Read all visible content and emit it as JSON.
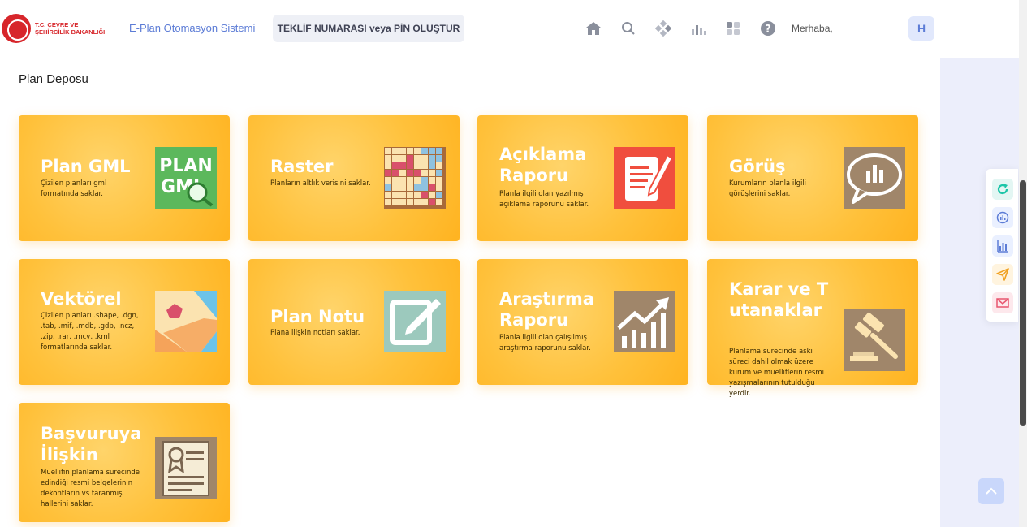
{
  "header": {
    "logo_line1": "T.C. ÇEVRE VE",
    "logo_line2": "ŞEHİRCİLİK BAKANLIĞI",
    "app_name": "E-Plan Otomasyon Sistemi",
    "teklif_label": "TEKLİF NUMARASI veya PİN OLUŞTUR",
    "greeting": "Merhaba,",
    "avatar_letter": "H",
    "icons": [
      "home-icon",
      "search-icon",
      "apps-icon",
      "chart-icon",
      "grid-icon",
      "help-icon"
    ]
  },
  "page": {
    "title": "Plan Deposu"
  },
  "cards": [
    {
      "title": "Plan GML",
      "desc": "Çizilen planları gml formatında saklar.",
      "icon": "plan-gml-icon"
    },
    {
      "title": "Raster",
      "desc": "Planların altlık verisini saklar.",
      "icon": "raster-grid-icon"
    },
    {
      "title": "Açıklama Raporu",
      "desc": "Planla ilgili olan yazılmış açıklama raporunu saklar.",
      "icon": "report-edit-icon"
    },
    {
      "title": "Görüş",
      "desc": "Kurumların planla ilgili görüşlerini saklar.",
      "icon": "speech-chart-icon"
    },
    {
      "title": "Vektörel",
      "desc": "Çizilen planları .shape, .dgn, .tab, .mif, .mdb, .gdb, .ncz, .zip, .rar, .mcv, .kml formatlarında saklar.",
      "icon": "vector-map-icon"
    },
    {
      "title": "Plan Notu",
      "desc": "Plana ilişkin notları saklar.",
      "icon": "note-edit-icon"
    },
    {
      "title": "Araştırma Raporu",
      "desc": "Planla ilgili olan çalışılmış araştırma raporunu saklar.",
      "icon": "growth-chart-icon"
    },
    {
      "title": "Karar ve Tutanaklar",
      "desc": "Planlama sürecinde askı süreci dahil olmak üzere kurum ve müelliflerin resmi yazışmalarının tutulduğu yerdir.",
      "icon": "gavel-icon"
    },
    {
      "title": "Başvuruya İlişkin",
      "desc": "Müellifin planlama sürecinde edindiği resmi belgelerinin dekontların vs taranmış hallerini saklar.",
      "icon": "certificate-icon"
    }
  ],
  "side_tools": [
    "refresh-icon",
    "stats-circle-icon",
    "bar-chart-icon",
    "send-icon",
    "mail-icon"
  ],
  "colors": {
    "card_orange": "#ffb320",
    "accent_blue": "#5c7cd6",
    "brand_red": "#d7262b"
  }
}
